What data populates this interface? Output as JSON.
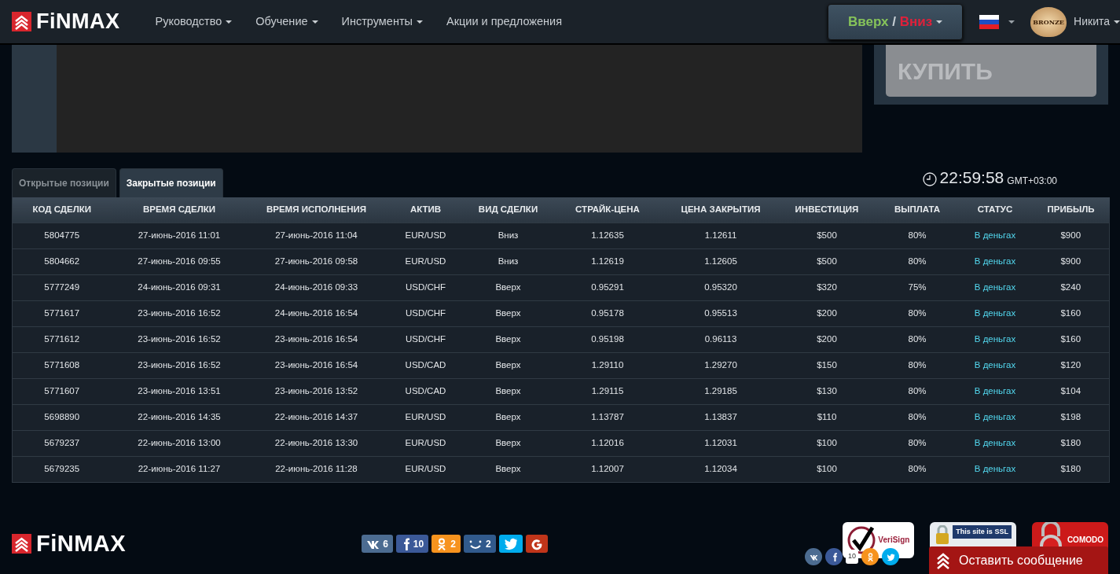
{
  "navbar": {
    "logo": "FiNMAX",
    "menu": [
      {
        "label": "Руководство",
        "dropdown": true
      },
      {
        "label": "Обучение",
        "dropdown": true
      },
      {
        "label": "Инструменты",
        "dropdown": true
      },
      {
        "label": "Акции и предложения",
        "dropdown": false
      }
    ],
    "trade_button": {
      "up": "Вверх",
      "separator": "/",
      "down": "Вниз"
    },
    "user": {
      "badge": "BRONZE",
      "name": "Никита"
    }
  },
  "buy_panel": {
    "button": "КУПИТЬ"
  },
  "tabs": [
    {
      "label": "Открытые позиции",
      "selected": false
    },
    {
      "label": "Закрытые позиции",
      "selected": true
    }
  ],
  "clock": {
    "time": "22:59:58",
    "zone": "GMT+03:00"
  },
  "table": {
    "columns": [
      "КОД СДЕЛКИ",
      "ВРЕМЯ СДЕЛКИ",
      "ВРЕМЯ ИСПОЛНЕНИЯ",
      "АКТИВ",
      "ВИД СДЕЛКИ",
      "СТРАЙК-ЦЕНА",
      "ЦЕНА ЗАКРЫТИЯ",
      "ИНВЕСТИЦИЯ",
      "ВЫПЛАТА",
      "СТАТУС",
      "ПРИБЫЛЬ"
    ],
    "rows": [
      [
        "5804775",
        "27-июнь-2016 11:01",
        "27-июнь-2016 11:04",
        "EUR/USD",
        "Вниз",
        "1.12635",
        "1.12611",
        "$500",
        "80%",
        "В деньгах",
        "$900"
      ],
      [
        "5804662",
        "27-июнь-2016 09:55",
        "27-июнь-2016 09:58",
        "EUR/USD",
        "Вниз",
        "1.12619",
        "1.12605",
        "$500",
        "80%",
        "В деньгах",
        "$900"
      ],
      [
        "5777249",
        "24-июнь-2016 09:31",
        "24-июнь-2016 09:33",
        "USD/CHF",
        "Вверх",
        "0.95291",
        "0.95320",
        "$320",
        "75%",
        "В деньгах",
        "$240"
      ],
      [
        "5771617",
        "23-июнь-2016 16:52",
        "24-июнь-2016 16:54",
        "USD/CHF",
        "Вверх",
        "0.95178",
        "0.95513",
        "$200",
        "80%",
        "В деньгах",
        "$160"
      ],
      [
        "5771612",
        "23-июнь-2016 16:52",
        "23-июнь-2016 16:54",
        "USD/CHF",
        "Вверх",
        "0.95198",
        "0.96113",
        "$200",
        "80%",
        "В деньгах",
        "$160"
      ],
      [
        "5771608",
        "23-июнь-2016 16:52",
        "23-июнь-2016 16:54",
        "USD/CAD",
        "Вверх",
        "1.29110",
        "1.29270",
        "$150",
        "80%",
        "В деньгах",
        "$120"
      ],
      [
        "5771607",
        "23-июнь-2016 13:51",
        "23-июнь-2016 13:52",
        "USD/CAD",
        "Вверх",
        "1.29115",
        "1.29185",
        "$130",
        "80%",
        "В деньгах",
        "$104"
      ],
      [
        "5698890",
        "22-июнь-2016 14:35",
        "22-июнь-2016 14:37",
        "EUR/USD",
        "Вверх",
        "1.13787",
        "1.13837",
        "$110",
        "80%",
        "В деньгах",
        "$198"
      ],
      [
        "5679237",
        "22-июнь-2016 13:00",
        "22-июнь-2016 13:30",
        "EUR/USD",
        "Вверх",
        "1.12016",
        "1.12031",
        "$100",
        "80%",
        "В деньгах",
        "$180"
      ],
      [
        "5679235",
        "22-июнь-2016 11:27",
        "22-июнь-2016 11:28",
        "EUR/USD",
        "Вверх",
        "1.12007",
        "1.12034",
        "$100",
        "80%",
        "В деньгах",
        "$180"
      ]
    ]
  },
  "footer": {
    "logo": "FiNMAX",
    "share_buttons": [
      {
        "kind": "vk",
        "count": "6"
      },
      {
        "kind": "facebook",
        "count": "10"
      },
      {
        "kind": "ok",
        "count": "2"
      },
      {
        "kind": "mailru",
        "count": "2"
      },
      {
        "kind": "twitter"
      },
      {
        "kind": "google"
      }
    ],
    "trust_badges": [
      {
        "kind": "verisign",
        "text": "VeriSign"
      },
      {
        "kind": "ssl",
        "text": "This site is SSL"
      },
      {
        "kind": "comodo",
        "text": "COMODO"
      }
    ],
    "round_share": [
      {
        "kind": "vk"
      },
      {
        "kind": "facebook",
        "count": "10"
      },
      {
        "kind": "ok"
      },
      {
        "kind": "twitter"
      }
    ],
    "chat_button": "Оставить сообщение"
  }
}
